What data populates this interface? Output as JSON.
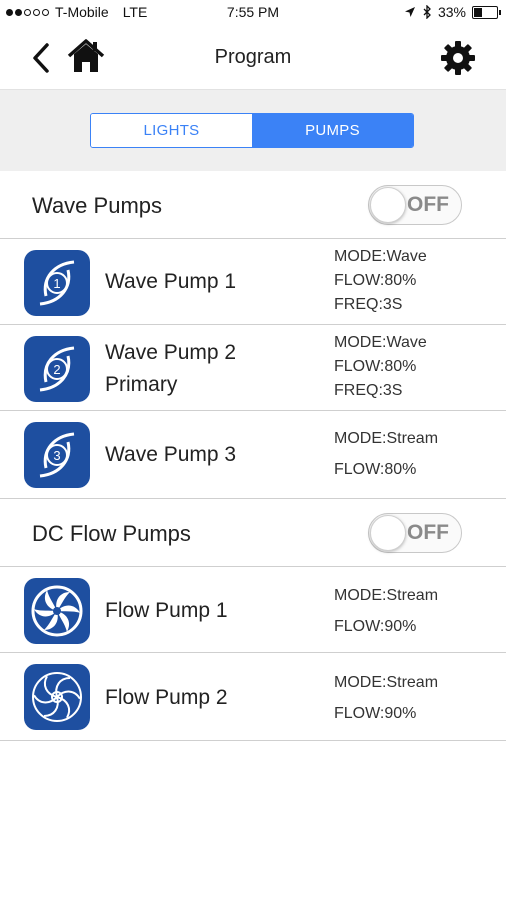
{
  "status_bar": {
    "carrier": "T-Mobile",
    "network": "LTE",
    "time": "7:55 PM",
    "battery": "33%",
    "battery_level": 0.33,
    "signal_dots": 2
  },
  "nav": {
    "title": "Program",
    "back_icon": "chevron-left-icon",
    "home_icon": "home-icon",
    "settings_icon": "gear-icon"
  },
  "segments": {
    "lights": "LIGHTS",
    "pumps": "PUMPS",
    "active": "pumps"
  },
  "colors": {
    "accent": "#3b82f6",
    "icon_bg": "#1e4fa0"
  },
  "wave_pumps": {
    "label": "Wave Pumps",
    "toggle": "OFF",
    "items": [
      {
        "name": "Wave Pump 1",
        "badge": "1",
        "stats": [
          "MODE:Wave",
          "FLOW:80%",
          "FREQ:3S"
        ]
      },
      {
        "name": "Wave Pump 2",
        "subtitle": "Primary",
        "badge": "2",
        "stats": [
          "MODE:Wave",
          "FLOW:80%",
          "FREQ:3S"
        ]
      },
      {
        "name": "Wave Pump 3",
        "badge": "3",
        "stats": [
          "MODE:Stream",
          "FLOW:80%"
        ]
      }
    ]
  },
  "dc_pumps": {
    "label": "DC Flow Pumps",
    "toggle": "OFF",
    "items": [
      {
        "name": "Flow Pump 1",
        "stats": [
          "MODE:Stream",
          "FLOW:90%"
        ]
      },
      {
        "name": "Flow Pump 2",
        "stats": [
          "MODE:Stream",
          "FLOW:90%"
        ]
      }
    ]
  }
}
